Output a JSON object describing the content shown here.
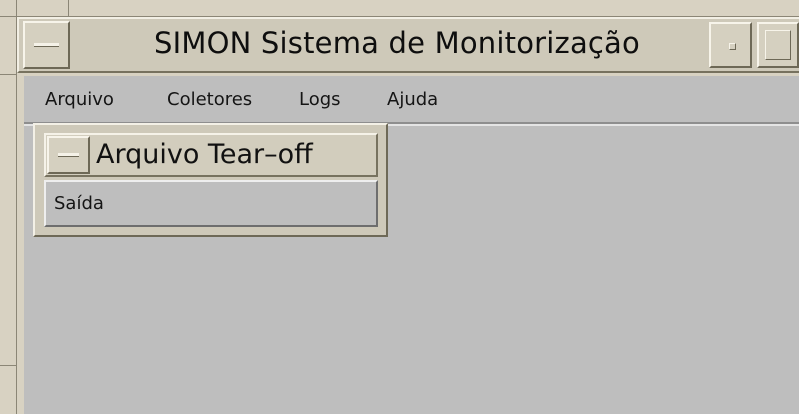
{
  "window": {
    "title": "SIMON Sistema de Monitorização",
    "menu_button_icon": "window-menu-icon",
    "minimize_button_icon": "minimize-icon",
    "maximize_button_icon": "maximize-icon"
  },
  "menubar": {
    "items": [
      {
        "label": "Arquivo"
      },
      {
        "label": "Coletores"
      },
      {
        "label": "Logs"
      },
      {
        "label": "Ajuda"
      }
    ]
  },
  "tearoff": {
    "title": "Arquivo Tear–off",
    "menu_button_icon": "window-menu-icon",
    "items": [
      {
        "label": "Saída"
      }
    ]
  },
  "colors": {
    "frame": "#d8d2c2",
    "titlebar": "#cec9b9",
    "client": "#bebebe"
  }
}
